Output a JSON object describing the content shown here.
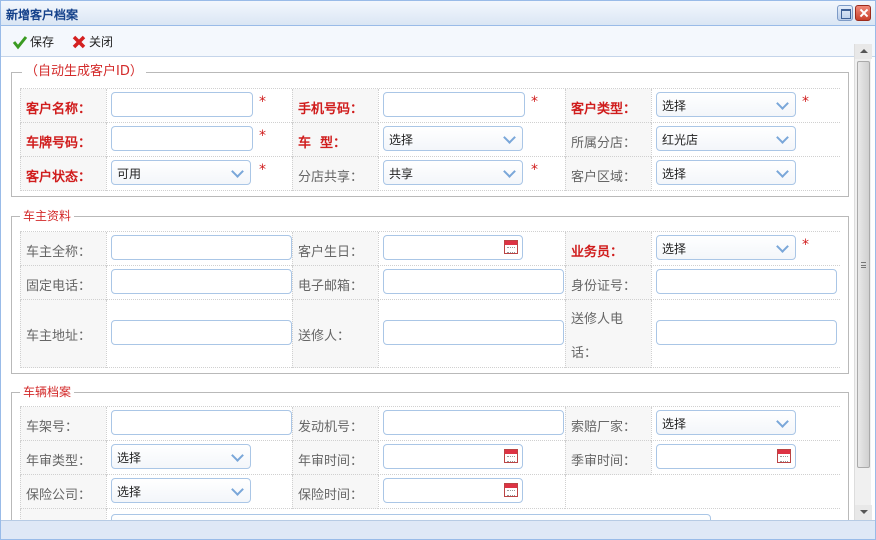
{
  "window": {
    "title": "新增客户档案"
  },
  "toolbar": {
    "save_label": "保存",
    "close_label": "关闭"
  },
  "section1": {
    "legend": "（自动生成客户ID）",
    "customer_name_label": "客户名称：",
    "mobile_label": "手机号码：",
    "customer_type_label": "客户类型：",
    "customer_type_value": "选择",
    "plate_label": "车牌号码：",
    "car_model_label": "车  型：",
    "car_model_value": "选择",
    "branch_label": "所属分店：",
    "branch_value": "红光店",
    "status_label": "客户状态：",
    "status_value": "可用",
    "share_label": "分店共享：",
    "share_value": "共享",
    "region_label": "客户区域：",
    "region_value": "选择",
    "required_mark": "*"
  },
  "section2": {
    "legend": "车主资料",
    "owner_name_label": "车主全称：",
    "birthday_label": "客户生日：",
    "salesman_label": "业务员：",
    "salesman_value": "选择",
    "phone_label": "固定电话：",
    "email_label": "电子邮箱：",
    "id_label": "身份证号：",
    "address_label": "车主地址：",
    "sender_label": "送修人：",
    "sender_phone_label_1": "送修人电",
    "sender_phone_label_2": "话："
  },
  "section3": {
    "legend": "车辆档案",
    "frame_label": "车架号：",
    "engine_label": "发动机号：",
    "claim_label": "索赔厂家：",
    "claim_value": "选择",
    "inspect_type_label": "年审类型：",
    "inspect_type_value": "选择",
    "annual_time_label": "年审时间：",
    "season_time_label": "季审时间：",
    "insurer_label": "保险公司：",
    "insurer_value": "选择",
    "insure_time_label": "保险时间：",
    "partial_value": "选择"
  }
}
